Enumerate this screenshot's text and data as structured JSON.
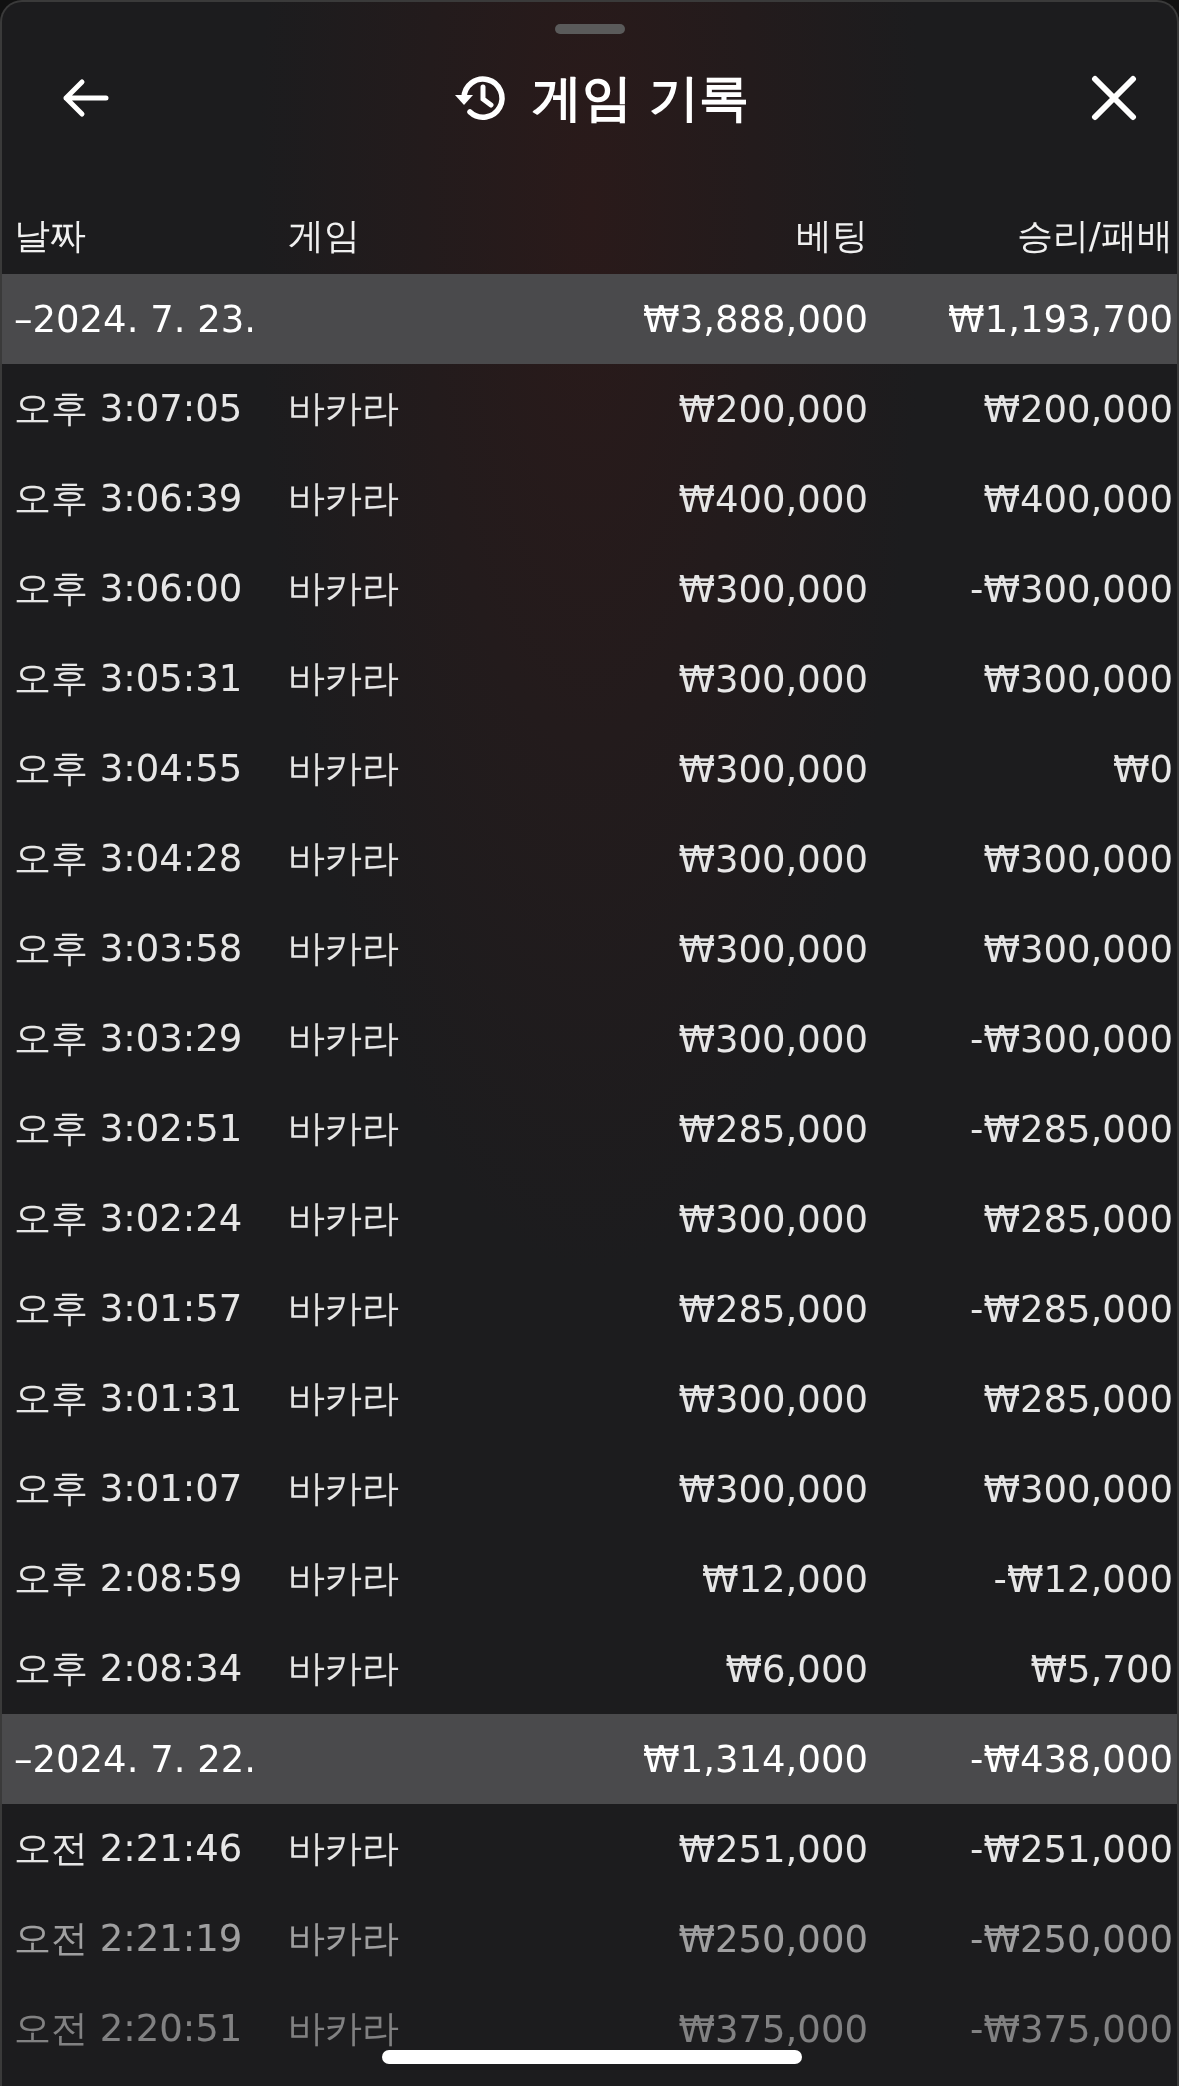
{
  "header": {
    "title": "게임 기록"
  },
  "columns": [
    "날짜",
    "게임",
    "베팅",
    "승리/패배"
  ],
  "groups": [
    {
      "date": "–2024. 7. 23.",
      "bet": "₩3,888,000",
      "result": "₩1,193,700",
      "rows": [
        {
          "time": "오후 3:07:05",
          "game": "바카라",
          "bet": "₩200,000",
          "result": "₩200,000"
        },
        {
          "time": "오후 3:06:39",
          "game": "바카라",
          "bet": "₩400,000",
          "result": "₩400,000"
        },
        {
          "time": "오후 3:06:00",
          "game": "바카라",
          "bet": "₩300,000",
          "result": "-₩300,000"
        },
        {
          "time": "오후 3:05:31",
          "game": "바카라",
          "bet": "₩300,000",
          "result": "₩300,000"
        },
        {
          "time": "오후 3:04:55",
          "game": "바카라",
          "bet": "₩300,000",
          "result": "₩0"
        },
        {
          "time": "오후 3:04:28",
          "game": "바카라",
          "bet": "₩300,000",
          "result": "₩300,000"
        },
        {
          "time": "오후 3:03:58",
          "game": "바카라",
          "bet": "₩300,000",
          "result": "₩300,000"
        },
        {
          "time": "오후 3:03:29",
          "game": "바카라",
          "bet": "₩300,000",
          "result": "-₩300,000"
        },
        {
          "time": "오후 3:02:51",
          "game": "바카라",
          "bet": "₩285,000",
          "result": "-₩285,000"
        },
        {
          "time": "오후 3:02:24",
          "game": "바카라",
          "bet": "₩300,000",
          "result": "₩285,000"
        },
        {
          "time": "오후 3:01:57",
          "game": "바카라",
          "bet": "₩285,000",
          "result": "-₩285,000"
        },
        {
          "time": "오후 3:01:31",
          "game": "바카라",
          "bet": "₩300,000",
          "result": "₩285,000"
        },
        {
          "time": "오후 3:01:07",
          "game": "바카라",
          "bet": "₩300,000",
          "result": "₩300,000"
        },
        {
          "time": "오후 2:08:59",
          "game": "바카라",
          "bet": "₩12,000",
          "result": "-₩12,000"
        },
        {
          "time": "오후 2:08:34",
          "game": "바카라",
          "bet": "₩6,000",
          "result": "₩5,700"
        }
      ]
    },
    {
      "date": "–2024. 7. 22.",
      "bet": "₩1,314,000",
      "result": "-₩438,000",
      "rows": [
        {
          "time": "오전 2:21:46",
          "game": "바카라",
          "bet": "₩251,000",
          "result": "-₩251,000"
        },
        {
          "time": "오전 2:21:19",
          "game": "바카라",
          "bet": "₩250,000",
          "result": "-₩250,000"
        },
        {
          "time": "오전 2:20:51",
          "game": "바카라",
          "bet": "₩375,000",
          "result": "-₩375,000"
        }
      ]
    }
  ]
}
